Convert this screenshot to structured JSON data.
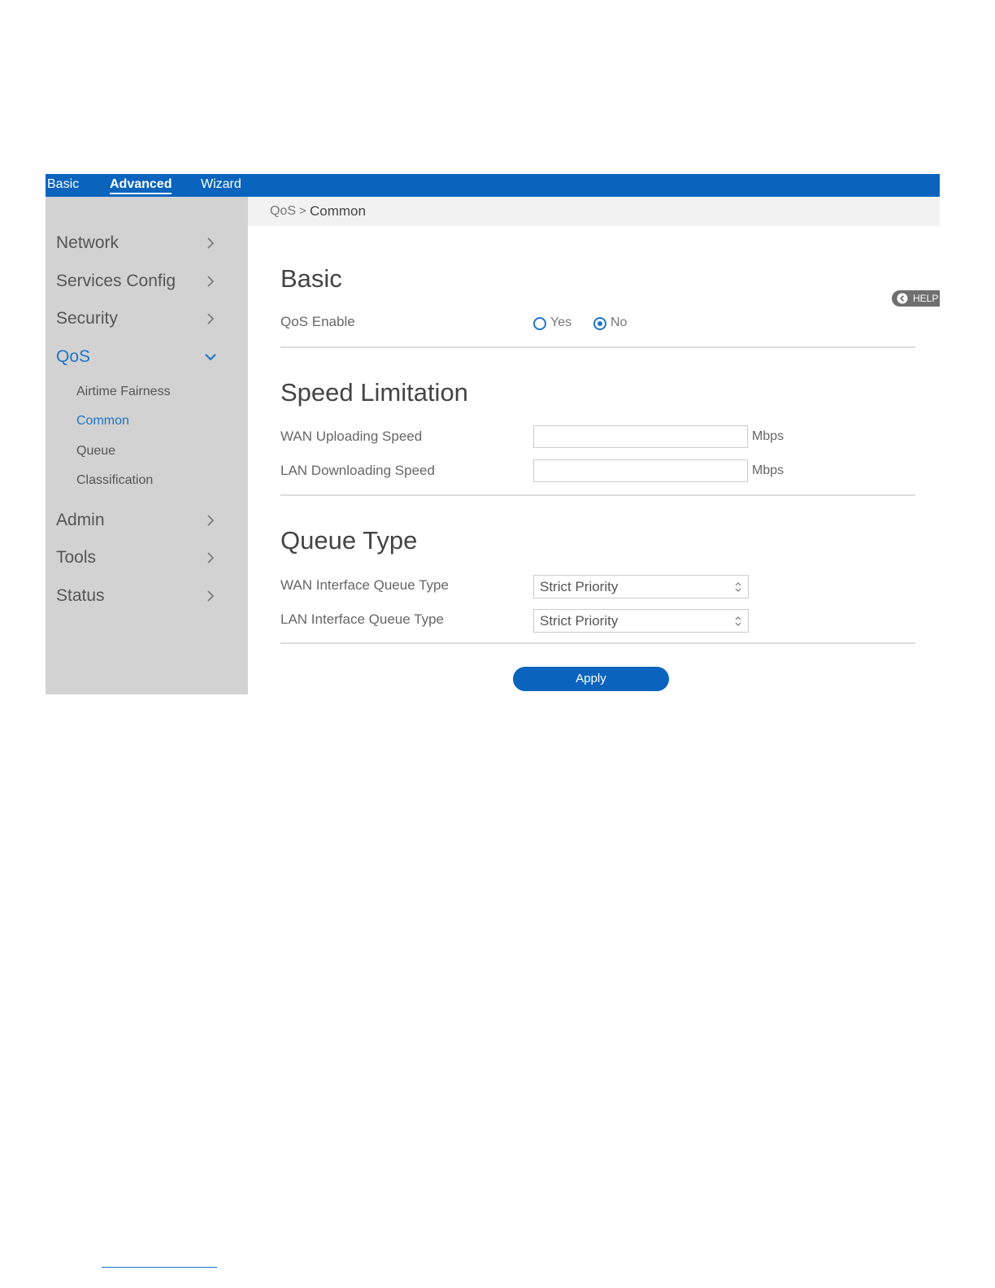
{
  "topnav": {
    "items": [
      {
        "label": "Basic"
      },
      {
        "label": "Advanced"
      },
      {
        "label": "Wizard"
      }
    ],
    "active": "Advanced"
  },
  "sidebar": {
    "items": [
      {
        "label": "Network"
      },
      {
        "label": "Services Config"
      },
      {
        "label": "Security"
      },
      {
        "label": "QoS",
        "expanded": true
      },
      {
        "label": "Admin"
      },
      {
        "label": "Tools"
      },
      {
        "label": "Status"
      }
    ],
    "qos_subitems": [
      {
        "label": "Airtime Fairness"
      },
      {
        "label": "Common",
        "selected": true
      },
      {
        "label": "Queue"
      },
      {
        "label": "Classification"
      }
    ]
  },
  "breadcrumb": {
    "parent": "QoS",
    "separator": ">",
    "current": "Common"
  },
  "help": {
    "label": "HELP",
    "icon": "chevron-left-circle-icon"
  },
  "basic": {
    "title": "Basic",
    "qos_enable": {
      "label": "QoS Enable",
      "options": [
        {
          "label": "Yes",
          "checked": false
        },
        {
          "label": "No",
          "checked": true
        }
      ]
    }
  },
  "speed_limitation": {
    "title": "Speed Limitation",
    "wan_upload": {
      "label": "WAN Uploading Speed",
      "value": "",
      "unit": "Mbps"
    },
    "lan_download": {
      "label": "LAN Downloading Speed",
      "value": "",
      "unit": "Mbps"
    }
  },
  "queue_type": {
    "title": "Queue Type",
    "wan": {
      "label": "WAN Interface Queue Type",
      "selected": "Strict Priority"
    },
    "lan": {
      "label": "LAN Interface Queue Type",
      "selected": "Strict Priority"
    }
  },
  "actions": {
    "apply_label": "Apply"
  },
  "colors": {
    "brand_blue": "#0a64bd",
    "active_link": "#1f74c6",
    "sidebar_bg": "#d2d2d2"
  }
}
